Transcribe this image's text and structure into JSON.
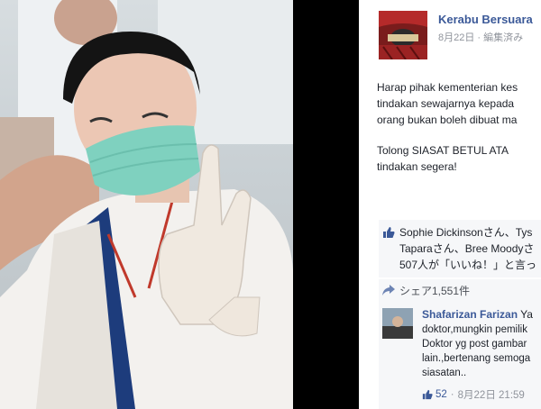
{
  "post": {
    "page_name": "Kerabu Bersuara",
    "date": "8月22日",
    "separator": "·",
    "edited": "編集済み",
    "body_lines": [
      "Harap pihak kementerian kes",
      "tindakan sewajarnya kepada",
      "orang bukan boleh dibuat ma",
      "",
      "Tolong SIASAT BETUL ATA",
      "tindakan segera!"
    ]
  },
  "likes": {
    "lines": [
      "Sophie Dickinsonさん、Tys",
      "Taparaさん、Bree Moodyさ",
      "507人が「いいね！」と言っ"
    ]
  },
  "share": {
    "label": "シェア1,551件"
  },
  "comment": {
    "author": "Shafarizan Farizan",
    "author_suffix": " Ya",
    "lines": [
      "doktor,mungkin pemilik",
      "Doktor yg post gambar",
      "lain.,bertenang semoga",
      "siasatan.."
    ],
    "like_count": "52",
    "separator": "·",
    "timestamp": "8月22日 21:59"
  },
  "colors": {
    "link_blue": "#3b5998",
    "meta_gray": "#90949c",
    "box_bg": "#f6f7f9",
    "mask_green": "#7fd1bf"
  }
}
